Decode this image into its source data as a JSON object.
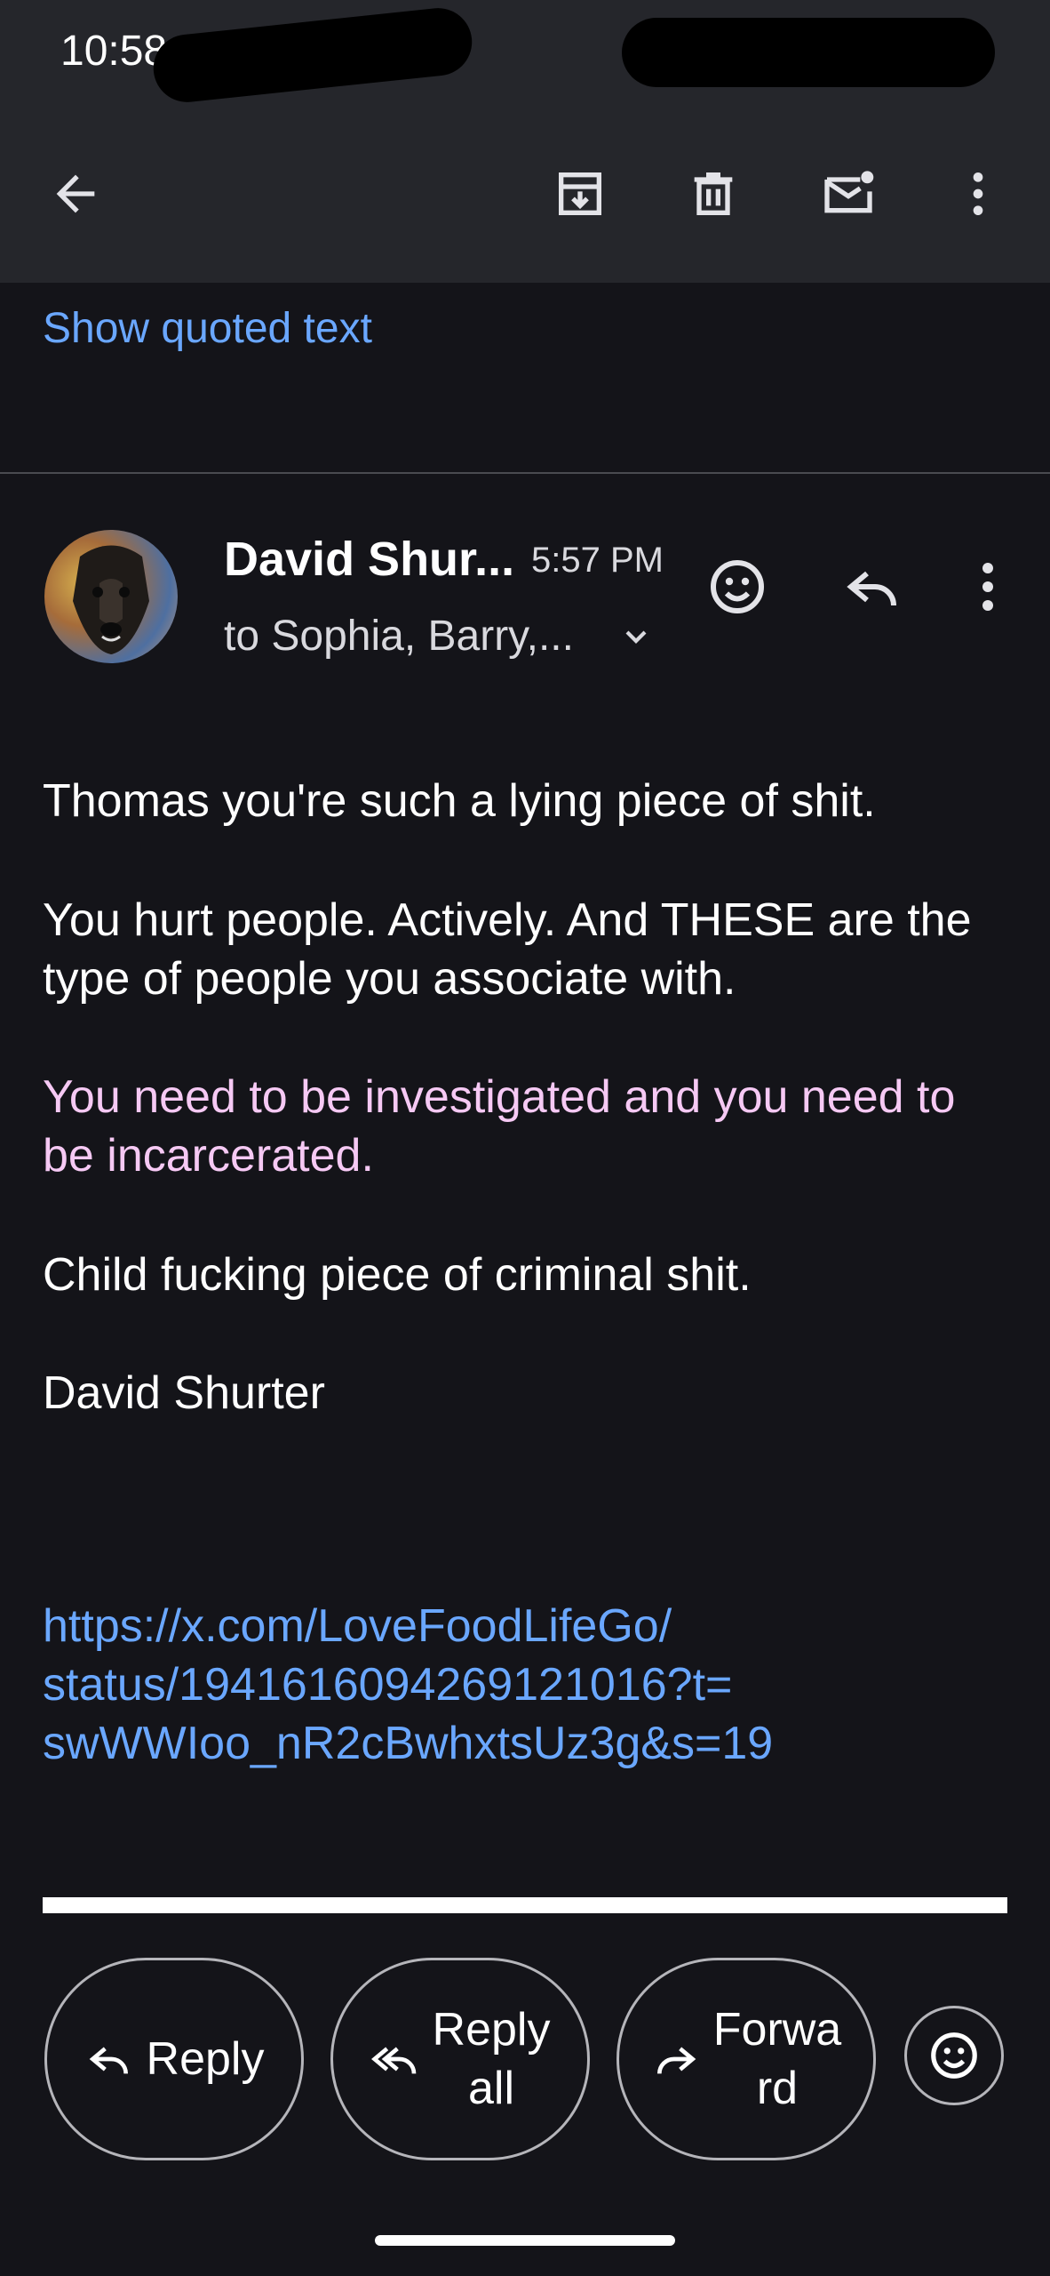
{
  "status_bar": {
    "time": "10:58"
  },
  "toolbar": {
    "back_icon": "arrow-left-icon",
    "archive_icon": "archive-icon",
    "delete_icon": "trash-icon",
    "mark_unread_icon": "mail-unread-icon",
    "more_icon": "more-vert-icon"
  },
  "thread": {
    "show_quoted_text": "Show quoted text"
  },
  "message": {
    "sender": "David Shur...",
    "time": "5:57 PM",
    "recipients": "to Sophia, Barry,...",
    "paragraphs": {
      "p1": "Thomas you're such a lying piece of shit.",
      "p2": "You hurt people. Actively. And THESE are the type of people you associate with.",
      "p3": "You need to be investigated and you need to be incarcerated.",
      "p4": "Child fucking piece of criminal shit.",
      "p5": "David Shurter"
    },
    "link_lines": {
      "l1": "https://x.com/LoveFoodLifeGo/",
      "l2": "status/1941616094269121016?t=",
      "l3": "swWWIoo_nR2cBwhxtsUz3g&s=19"
    }
  },
  "actions": {
    "reply": "Reply",
    "reply_all_line1": "Reply",
    "reply_all_line2": "all",
    "forward_line1": "Forwa",
    "forward_line2": "rd"
  },
  "colors": {
    "background": "#141419",
    "toolbar": "#25262b",
    "link": "#6aa7ff",
    "highlight_text": "#f6c9f4"
  }
}
